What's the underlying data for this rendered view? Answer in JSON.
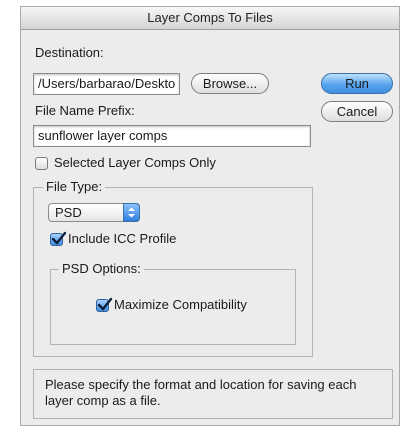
{
  "window": {
    "title": "Layer Comps To Files"
  },
  "destination": {
    "label": "Destination:",
    "path_value": "/Users/barbarao/Deskto",
    "browse_label": "Browse..."
  },
  "buttons": {
    "run_label": "Run",
    "cancel_label": "Cancel"
  },
  "prefix": {
    "label": "File Name Prefix:",
    "value": "sunflower layer comps"
  },
  "selected_only": {
    "label": "Selected Layer Comps Only",
    "checked": false
  },
  "file_type": {
    "legend": "File Type:",
    "selected": "PSD",
    "include_icc": {
      "label": "Include ICC Profile",
      "checked": true
    },
    "psd_options": {
      "legend": "PSD Options:",
      "maximize": {
        "label": "Maximize Compatibility",
        "checked": true
      }
    }
  },
  "message": {
    "line1": "Please specify the format and location for saving each",
    "line2": "layer comp as a file."
  },
  "colors": {
    "accent": "#3d8fe0",
    "dialog_bg": "#ececec"
  }
}
